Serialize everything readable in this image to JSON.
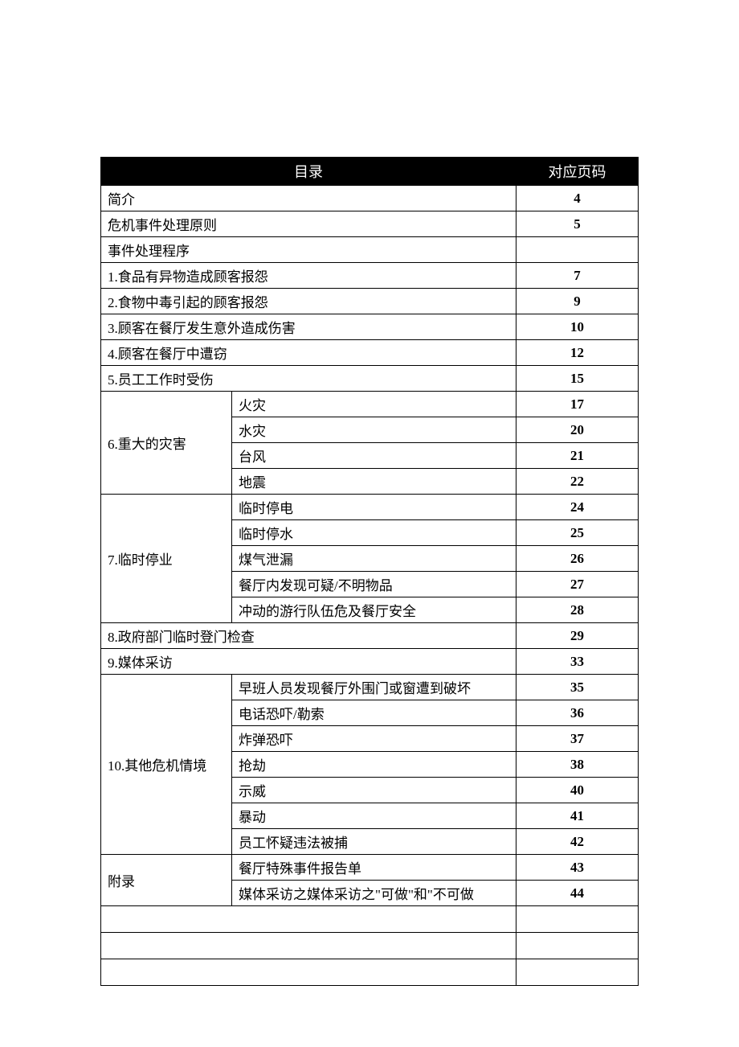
{
  "header": {
    "title": "目录",
    "page_col": "对应页码"
  },
  "rows": [
    {
      "type": "full",
      "label": "简介",
      "page": "4"
    },
    {
      "type": "full",
      "label": "危机事件处理原则",
      "page": "5"
    },
    {
      "type": "full",
      "label": "事件处理程序",
      "page": ""
    },
    {
      "type": "full",
      "label": "1.食品有异物造成顾客报怨",
      "page": "7"
    },
    {
      "type": "full",
      "label": "2.食物中毒引起的顾客报怨",
      "page": "9"
    },
    {
      "type": "full",
      "label": "3.顾客在餐厅发生意外造成伤害",
      "page": "10"
    },
    {
      "type": "full",
      "label": "4.顾客在餐厅中遭窃",
      "page": "12"
    },
    {
      "type": "full",
      "label": "5.员工工作时受伤",
      "page": "15"
    },
    {
      "type": "group_start",
      "group_label": "6.重大的灾害",
      "rowspan": 4,
      "sub": "火灾",
      "page": "17"
    },
    {
      "type": "group_cont",
      "sub": "水灾",
      "page": "20"
    },
    {
      "type": "group_cont",
      "sub": "台风",
      "page": "21"
    },
    {
      "type": "group_cont",
      "sub": "地震",
      "page": "22"
    },
    {
      "type": "group_start",
      "group_label": "7.临时停业",
      "rowspan": 5,
      "sub": "临时停电",
      "page": "24"
    },
    {
      "type": "group_cont",
      "sub": "临时停水",
      "page": "25"
    },
    {
      "type": "group_cont",
      "sub": "煤气泄漏",
      "page": "26"
    },
    {
      "type": "group_cont",
      "sub": "餐厅内发现可疑/不明物品",
      "page": "27"
    },
    {
      "type": "group_cont",
      "sub": "冲动的游行队伍危及餐厅安全",
      "page": "28"
    },
    {
      "type": "full",
      "label": "8.政府部门临时登门检查",
      "page": "29"
    },
    {
      "type": "full",
      "label": "9.媒体采访",
      "page": "33"
    },
    {
      "type": "group_start",
      "group_label": "10.其他危机情境",
      "rowspan": 7,
      "sub": "早班人员发现餐厅外围门或窗遭到破坏",
      "page": "35"
    },
    {
      "type": "group_cont",
      "sub": "电话恐吓/勒索",
      "page": "36"
    },
    {
      "type": "group_cont",
      "sub": "炸弹恐吓",
      "page": "37"
    },
    {
      "type": "group_cont",
      "sub": "抢劫",
      "page": "38"
    },
    {
      "type": "group_cont",
      "sub": "示威",
      "page": "40"
    },
    {
      "type": "group_cont",
      "sub": "暴动",
      "page": "41"
    },
    {
      "type": "group_cont",
      "sub": "员工怀疑违法被捕",
      "page": "42"
    },
    {
      "type": "group_start",
      "group_label": "附录",
      "rowspan": 2,
      "sub": "餐厅特殊事件报告单",
      "page": "43"
    },
    {
      "type": "group_cont",
      "sub": "媒体采访之媒体采访之\"可做\"和\"不可做",
      "page": "44"
    },
    {
      "type": "empty"
    },
    {
      "type": "empty"
    },
    {
      "type": "empty"
    }
  ]
}
